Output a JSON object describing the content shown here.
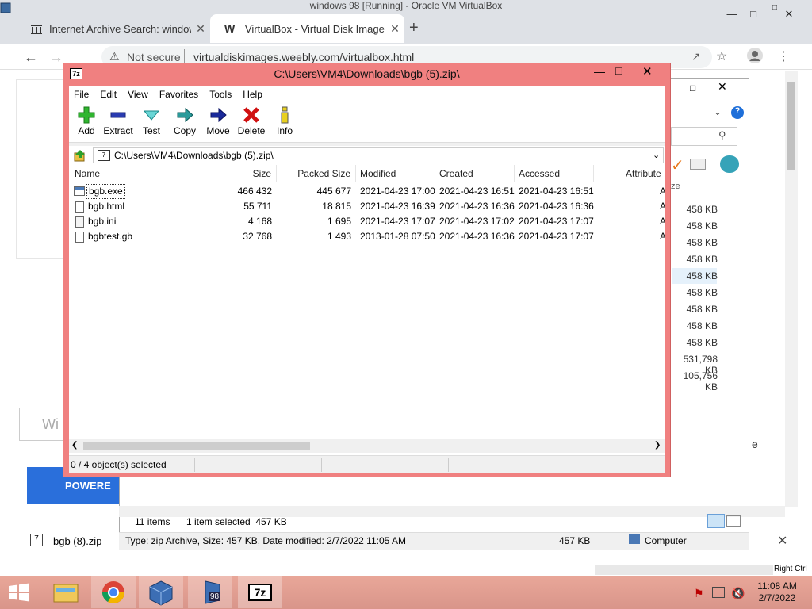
{
  "vbox_title": "windows 98 [Running] - Oracle VM VirtualBox",
  "browser": {
    "tabs": [
      {
        "title": "Internet Archive Search: windows"
      },
      {
        "title": "VirtualBox - Virtual Disk Images"
      }
    ],
    "new_tab": "+",
    "security": "Not secure",
    "url": "virtualdiskimages.weebly.com/virtualbox.html",
    "search_placeholder": "Wi",
    "powered": "POWERE",
    "download_item": "bgb (8).zip"
  },
  "explorer": {
    "sizes": [
      "458 KB",
      "458 KB",
      "458 KB",
      "458 KB",
      "458 KB",
      "458 KB",
      "458 KB",
      "458 KB",
      "458 KB",
      "531,798 KB",
      "105,756 KB"
    ],
    "size_header": "ze",
    "item_count": "11 items",
    "selection": "1 item selected  457 KB",
    "details": "Type: zip Archive, Size: 457 KB, Date modified: 2/7/2022 11:05 AM",
    "details_size": "457 KB",
    "details_location": "Computer"
  },
  "sevenzip": {
    "title": "C:\\Users\\VM4\\Downloads\\bgb (5).zip\\",
    "menu": [
      "File",
      "Edit",
      "View",
      "Favorites",
      "Tools",
      "Help"
    ],
    "toolbar": [
      "Add",
      "Extract",
      "Test",
      "Copy",
      "Move",
      "Delete",
      "Info"
    ],
    "address": "C:\\Users\\VM4\\Downloads\\bgb (5).zip\\",
    "columns": [
      "Name",
      "Size",
      "Packed Size",
      "Modified",
      "Created",
      "Accessed",
      "Attribute"
    ],
    "files": [
      {
        "name": "bgb.exe",
        "size": "466 432",
        "packed": "445 677",
        "modified": "2021-04-23 17:00",
        "created": "2021-04-23 16:51",
        "accessed": "2021-04-23 16:51",
        "attr": "A"
      },
      {
        "name": "bgb.html",
        "size": "55 711",
        "packed": "18 815",
        "modified": "2021-04-23 16:39",
        "created": "2021-04-23 16:36",
        "accessed": "2021-04-23 16:36",
        "attr": "A"
      },
      {
        "name": "bgb.ini",
        "size": "4 168",
        "packed": "1 695",
        "modified": "2021-04-23 17:07",
        "created": "2021-04-23 17:02",
        "accessed": "2021-04-23 17:07",
        "attr": "A"
      },
      {
        "name": "bgbtest.gb",
        "size": "32 768",
        "packed": "1 493",
        "modified": "2013-01-28 07:50",
        "created": "2021-04-23 16:36",
        "accessed": "2021-04-23 17:07",
        "attr": "A"
      }
    ],
    "status": "0 / 4 object(s) selected"
  },
  "taskbar": {
    "time": "11:08 AM",
    "date": "2/7/2022",
    "host_key": "Right Ctrl",
    "vbox_badge": "98",
    "sevenzip_label": "7z"
  }
}
